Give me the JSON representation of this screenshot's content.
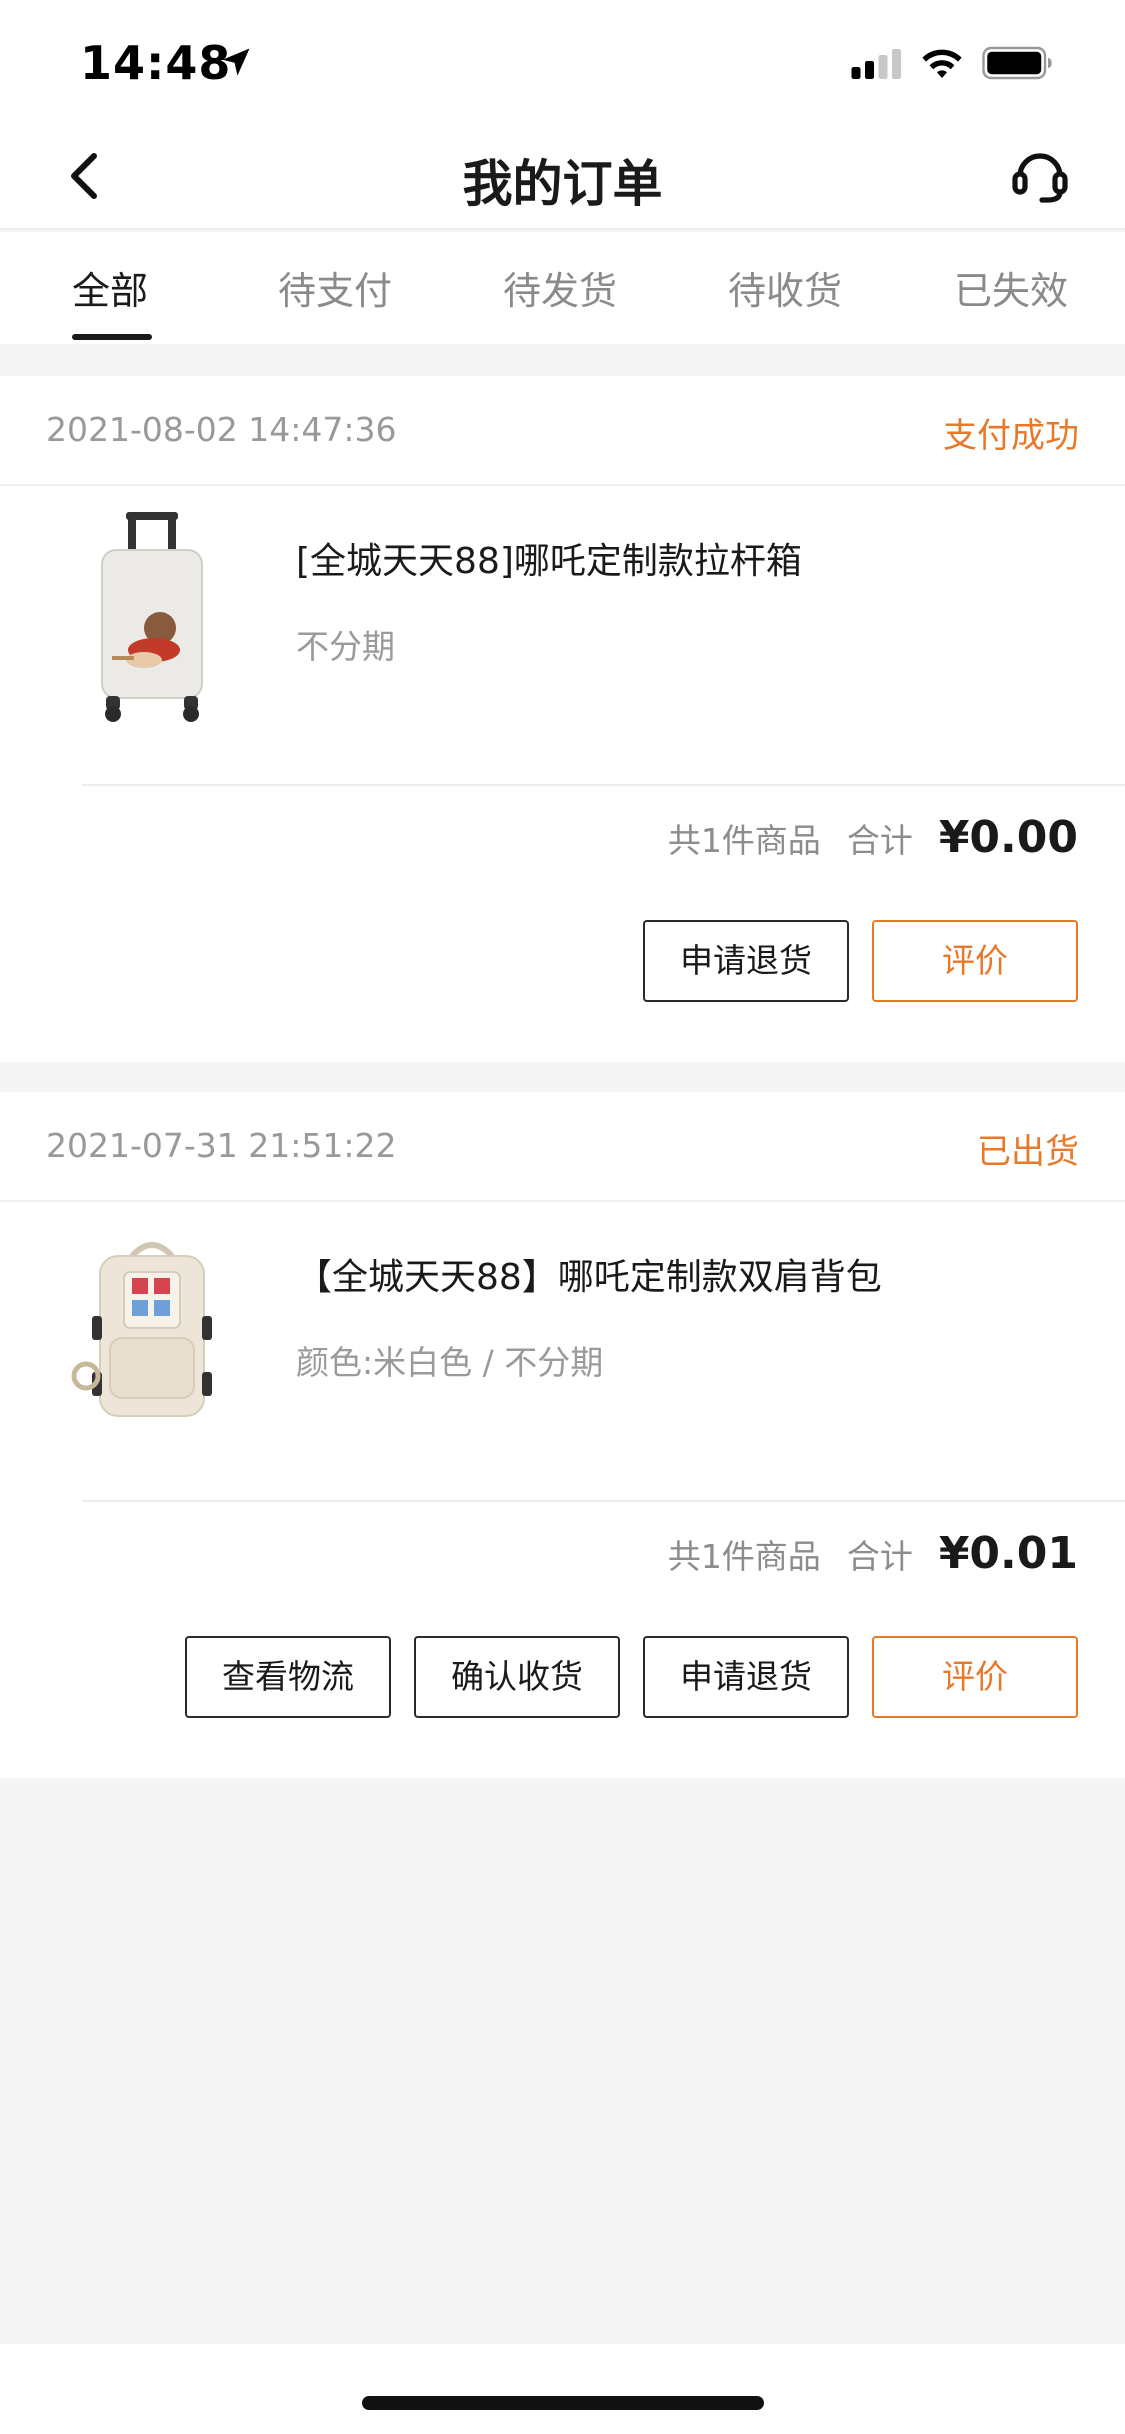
{
  "status_bar": {
    "time": "14:48"
  },
  "nav": {
    "title": "我的订单"
  },
  "tabs": [
    {
      "label": "全部",
      "active": true
    },
    {
      "label": "待支付",
      "active": false
    },
    {
      "label": "待发货",
      "active": false
    },
    {
      "label": "待收货",
      "active": false
    },
    {
      "label": "已失效",
      "active": false
    }
  ],
  "orders": [
    {
      "date": "2021-08-02 14:47:36",
      "status": "支付成功",
      "product": {
        "name": "[全城天天88]哪吒定制款拉杆箱",
        "spec": "不分期",
        "thumb_icon": "luggage-image"
      },
      "count_text": "共1件商品",
      "total_label": "合计",
      "total": "¥0.00",
      "buttons": [
        "申请退货",
        "评价"
      ]
    },
    {
      "date": "2021-07-31 21:51:22",
      "status": "已出货",
      "product": {
        "name": "【全城天天88】哪吒定制款双肩背包",
        "spec": "颜色:米白色 / 不分期",
        "thumb_icon": "backpack-image"
      },
      "count_text": "共1件商品",
      "total_label": "合计",
      "total": "¥0.01",
      "buttons": [
        "查看物流",
        "确认收货",
        "申请退货",
        "评价"
      ]
    }
  ],
  "colors": {
    "accent": "#e8782a",
    "background": "#f5f5f5",
    "text_primary": "#1a1a1a",
    "text_secondary": "#999999"
  }
}
